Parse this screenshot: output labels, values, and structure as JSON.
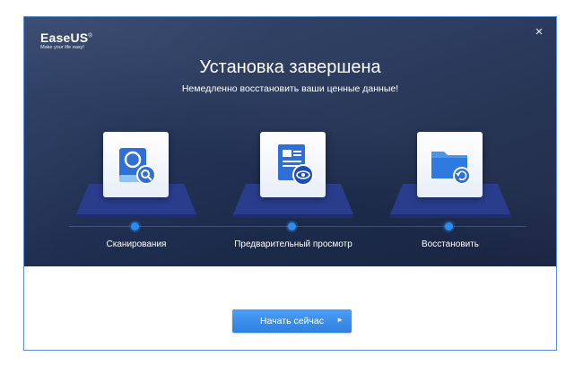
{
  "app": {
    "brand": "EaseUS",
    "trademark": "®",
    "tagline": "Make your life easy!",
    "close_glyph": "×"
  },
  "hero": {
    "title": "Установка завершена",
    "subtitle": "Немедленно восстановить ваши ценные данные!"
  },
  "steps": [
    {
      "label": "Сканирования",
      "icon": "scan-search-icon"
    },
    {
      "label": "Предварительный просмотр",
      "icon": "preview-document-icon"
    },
    {
      "label": "Восстановить",
      "icon": "recover-folder-icon"
    }
  ],
  "cta": {
    "label": "Начать сейчас",
    "arrow_glyph": "►"
  },
  "colors": {
    "hero_bg": "#22314f",
    "accent": "#2f80e0",
    "window_border": "#5b8fd6"
  }
}
